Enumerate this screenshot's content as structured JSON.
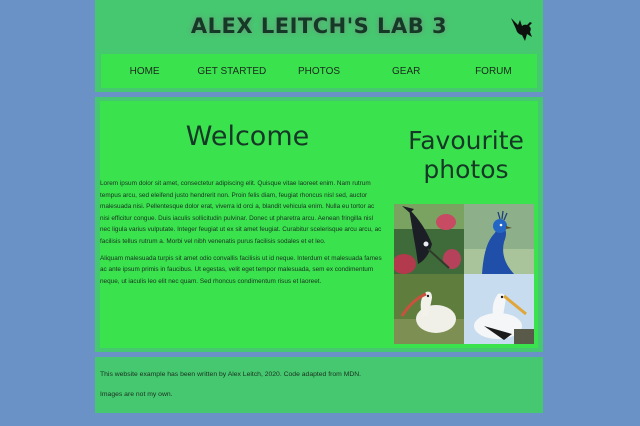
{
  "header": {
    "title": "ALEX LEITCH'S LAB 3",
    "logo_icon": "bird-icon"
  },
  "nav": {
    "items": [
      "HOME",
      "GET STARTED",
      "PHOTOS",
      "GEAR",
      "FORUM"
    ]
  },
  "article": {
    "title": "Welcome",
    "paragraphs": [
      "Lorem ipsum dolor sit amet, consectetur adipiscing elit. Quisque vitae laoreet enim. Nam rutrum tempus arcu, sed eleifend justo hendrerit non. Proin felis diam, feugiat rhoncus nisl sed, auctor malesuada nisi. Pellentesque dolor erat, viverra id orci a, blandit vehicula enim. Nulla eu tortor ac nisi efficitur congue. Duis iaculis sollicitudin pulvinar. Donec ut pharetra arcu. Aenean fringilla nisl nec ligula varius vulputate. Integer feugiat ut ex sit amet feugiat. Curabitur scelerisque arcu arcu, ac facilisis tellus rutrum a. Morbi vel nibh venenatis purus facilisis sodales et et leo.",
      "Aliquam malesuada turpis sit amet odio convallis facilisis ut id neque. Interdum et malesuada fames ac ante ipsum primis in faucibus. Ut egestas, velit eget tempor malesuada, sem ex condimentum neque, ut iaculis leo elit nec quam. Sed rhoncus condimentum risus et laoreet."
    ]
  },
  "aside": {
    "title": "Favourite photos",
    "photos": [
      "tui-bird-photo",
      "peacock-photo",
      "ibis-photo",
      "stork-photo"
    ]
  },
  "footer": {
    "line1": "This website example has been written by Alex Leitch, 2020. Code adapted from MDN.",
    "line2": "Images are not my own."
  },
  "colors": {
    "page_bg": "#6a92c6",
    "panel": "#46c870",
    "panel_bright": "#3ae34e",
    "text_dark": "#163826"
  }
}
